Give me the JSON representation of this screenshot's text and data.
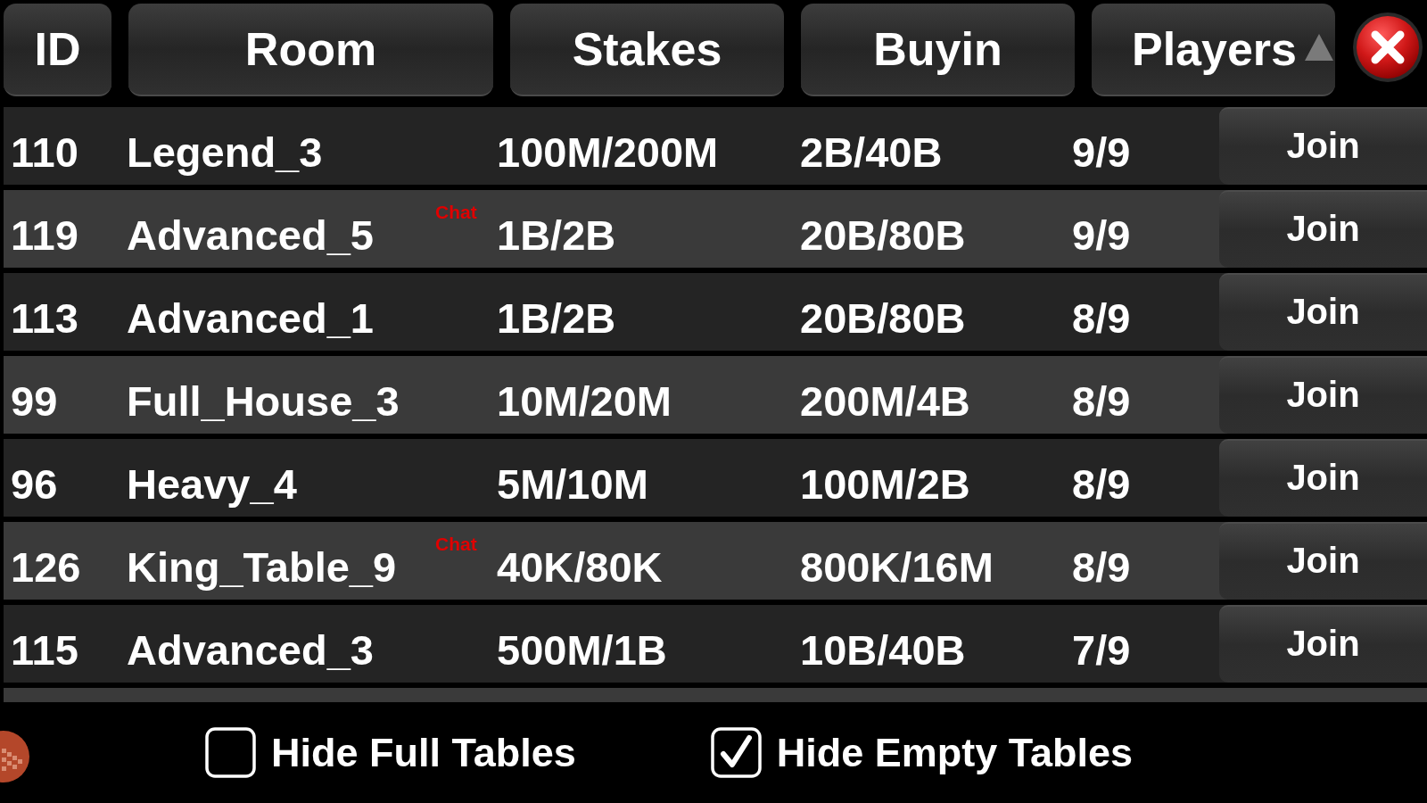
{
  "columns": [
    {
      "label": "ID",
      "sorted": false
    },
    {
      "label": "Room",
      "sorted": false
    },
    {
      "label": "Stakes",
      "sorted": false
    },
    {
      "label": "Buyin",
      "sorted": false
    },
    {
      "label": "Players",
      "sorted": true
    }
  ],
  "rows": [
    {
      "id": "110",
      "room": "Legend_3",
      "stakes": "100M/200M",
      "buyin": "2B/40B",
      "players": "9/9",
      "button": "Join"
    },
    {
      "id": "119",
      "room": "Advanced_5",
      "tag": "Chat",
      "stakes": "1B/2B",
      "buyin": "20B/80B",
      "players": "9/9",
      "button": "Join"
    },
    {
      "id": "113",
      "room": "Advanced_1",
      "stakes": "1B/2B",
      "buyin": "20B/80B",
      "players": "8/9",
      "button": "Join"
    },
    {
      "id": "99",
      "room": "Full_House_3",
      "stakes": "10M/20M",
      "buyin": "200M/4B",
      "players": "8/9",
      "button": "Join"
    },
    {
      "id": "96",
      "room": "Heavy_4",
      "stakes": "5M/10M",
      "buyin": "100M/2B",
      "players": "8/9",
      "button": "Join"
    },
    {
      "id": "126",
      "room": "King_Table_9",
      "tag": "Chat",
      "stakes": "40K/80K",
      "buyin": "800K/16M",
      "players": "8/9",
      "button": "Join"
    },
    {
      "id": "115",
      "room": "Advanced_3",
      "stakes": "500M/1B",
      "buyin": "10B/40B",
      "players": "7/9",
      "button": "Join"
    }
  ],
  "options": [
    {
      "label": "Hide Full Tables",
      "checked": false
    },
    {
      "label": "Hide Empty Tables",
      "checked": true
    }
  ]
}
